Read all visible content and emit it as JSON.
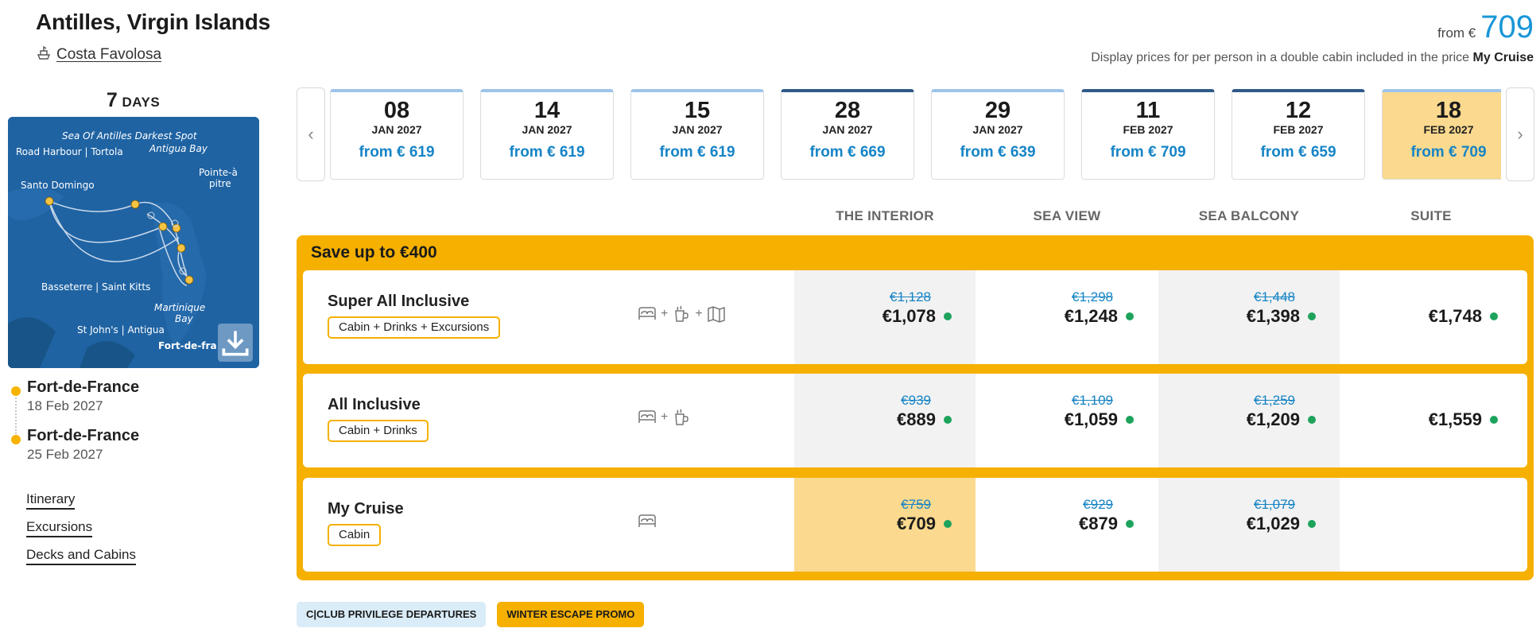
{
  "header": {
    "title": "Antilles, Virgin Islands",
    "ship": "Costa Favolosa",
    "from_label": "from €",
    "from_price": "709",
    "note_prefix": "Display prices for per person in a double cabin included in the price",
    "note_bold": "My Cruise"
  },
  "left": {
    "days_number": "7",
    "days_label": "DAYS",
    "map_labels": {
      "sea": "Sea Of Antilles Darkest Spot",
      "road_harbour": "Road Harbour | Tortola",
      "antigua_bay": "Antigua Bay",
      "pointe_a_pitre_1": "Pointe-à",
      "pointe_a_pitre_2": "pitre",
      "santo_domingo": "Santo Domingo",
      "basseterre": "Basseterre | Saint Kitts",
      "martinique_1": "Martinique",
      "martinique_2": "Bay",
      "st_johns": "St John's | Antigua",
      "fort_de_france": "Fort-de-fra"
    },
    "ports": [
      {
        "name": "Fort-de-France",
        "date": "18 Feb 2027"
      },
      {
        "name": "Fort-de-France",
        "date": "25 Feb 2027"
      }
    ],
    "links": [
      "Itinerary",
      "Excursions",
      "Decks and Cabins"
    ]
  },
  "dates": [
    {
      "day": "08",
      "month": "JAN 2027",
      "price": "from € 619",
      "style": "light"
    },
    {
      "day": "14",
      "month": "JAN 2027",
      "price": "from € 619",
      "style": "light"
    },
    {
      "day": "15",
      "month": "JAN 2027",
      "price": "from € 619",
      "style": "light"
    },
    {
      "day": "28",
      "month": "JAN 2027",
      "price": "from € 669",
      "style": "dark"
    },
    {
      "day": "29",
      "month": "JAN 2027",
      "price": "from € 639",
      "style": "light"
    },
    {
      "day": "11",
      "month": "FEB 2027",
      "price": "from € 709",
      "style": "dark"
    },
    {
      "day": "12",
      "month": "FEB 2027",
      "price": "from € 659",
      "style": "dark"
    },
    {
      "day": "18",
      "month": "FEB 2027",
      "price": "from € 709",
      "style": "selected"
    }
  ],
  "columns": [
    "THE INTERIOR",
    "SEA VIEW",
    "SEA BALCONY",
    "SUITE"
  ],
  "offer": {
    "title": "Save up to €400",
    "rows": [
      {
        "name": "Super All Inclusive",
        "tag": "Cabin + Drinks + Excursions",
        "prices": [
          {
            "old": "€1,128",
            "new": "€1,078"
          },
          {
            "old": "€1,298",
            "new": "€1,248"
          },
          {
            "old": "€1,448",
            "new": "€1,398"
          },
          {
            "old": "",
            "new": "€1,748"
          }
        ]
      },
      {
        "name": "All Inclusive",
        "tag": "Cabin + Drinks",
        "prices": [
          {
            "old": "€939",
            "new": "€889"
          },
          {
            "old": "€1,109",
            "new": "€1,059"
          },
          {
            "old": "€1,259",
            "new": "€1,209"
          },
          {
            "old": "",
            "new": "€1,559"
          }
        ]
      },
      {
        "name": "My Cruise",
        "tag": "Cabin",
        "prices": [
          {
            "old": "€759",
            "new": "€709"
          },
          {
            "old": "€929",
            "new": "€879"
          },
          {
            "old": "€1,079",
            "new": "€1,029"
          },
          {
            "old": "",
            "new": ""
          }
        ]
      }
    ]
  },
  "icons": {
    "plus": "+",
    "bed": "bed-icon",
    "drinks": "drinks-icon",
    "excursions": "map-icon",
    "ship": "ship-icon",
    "download": "download-icon"
  },
  "promos": [
    "C|CLUB PRIVILEGE DEPARTURES",
    "WINTER ESCAPE PROMO"
  ],
  "colors": {
    "accent_gold": "#f5b000",
    "selected_date": "#fbd98e",
    "price_blue": "#1684c6",
    "available_green": "#1da35c"
  }
}
